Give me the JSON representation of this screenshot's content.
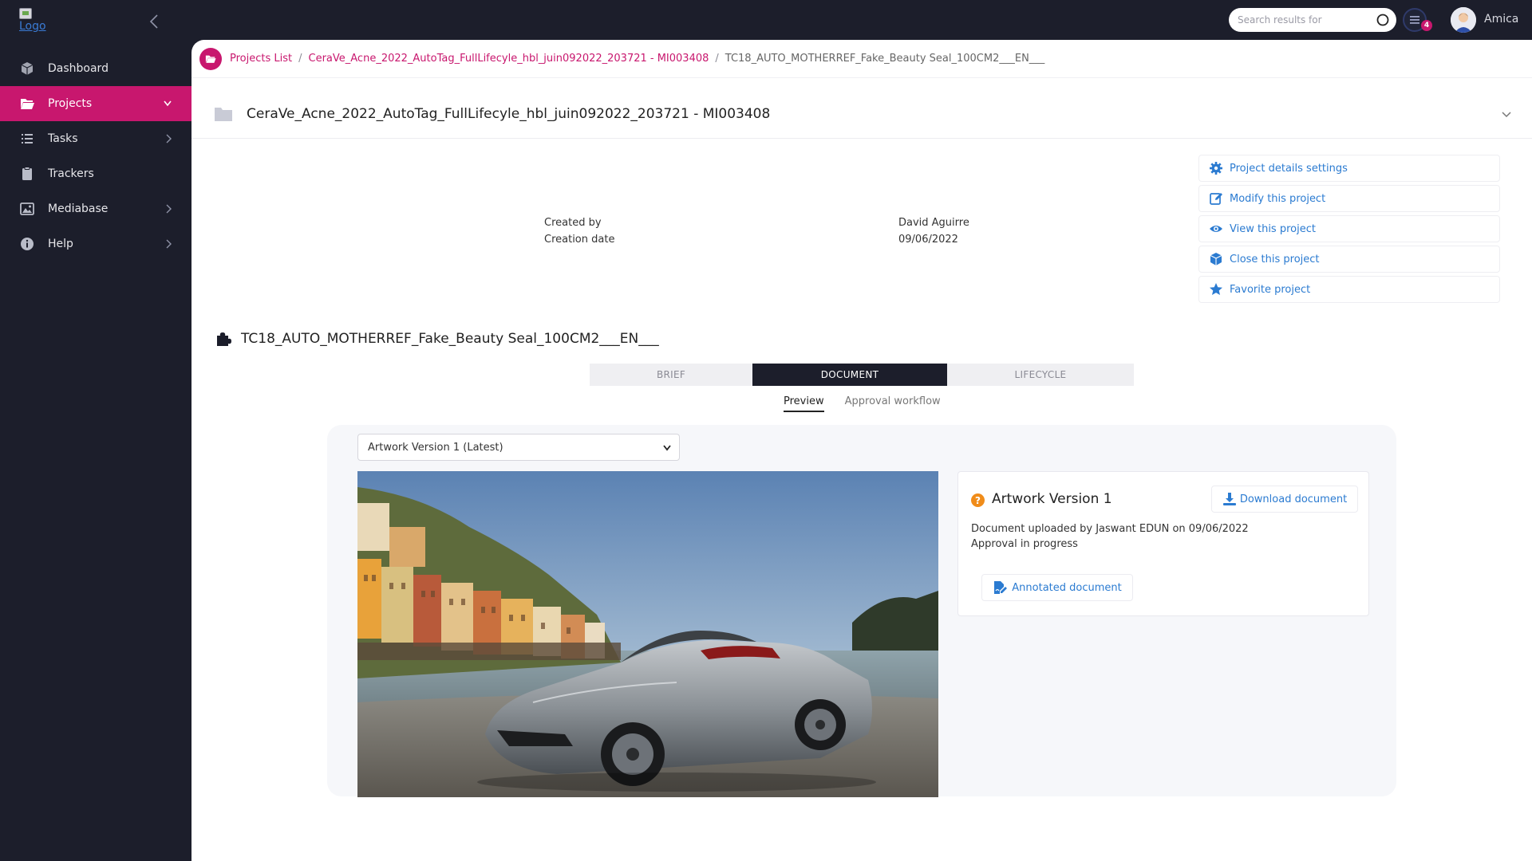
{
  "sidebar": {
    "logo_alt": "Logo",
    "items": [
      {
        "label": "Dashboard",
        "icon": "cube-icon",
        "has_children": false
      },
      {
        "label": "Projects",
        "icon": "folder-open-icon",
        "has_children": true,
        "active": true
      },
      {
        "label": "Tasks",
        "icon": "list-icon",
        "has_children": true
      },
      {
        "label": "Trackers",
        "icon": "clipboard-icon",
        "has_children": false
      },
      {
        "label": "Mediabase",
        "icon": "image-icon",
        "has_children": true
      },
      {
        "label": "Help",
        "icon": "info-icon",
        "has_children": true
      }
    ]
  },
  "topbar": {
    "search_placeholder": "Search results for",
    "notification_count": "4",
    "username": "Amica"
  },
  "breadcrumb": {
    "items": [
      "Projects List",
      "CeraVe_Acne_2022_AutoTag_FullLifecyle_hbl_juin092022_203721 - MI003408"
    ],
    "current": "TC18_AUTO_MOTHERREF_Fake_Beauty Seal_100CM2___EN___"
  },
  "project": {
    "title": "CeraVe_Acne_2022_AutoTag_FullLifecyle_hbl_juin092022_203721 - MI003408",
    "created_by_label": "Created by",
    "creation_date_label": "Creation date",
    "created_by": "David Aguirre",
    "creation_date": "09/06/2022"
  },
  "actions": [
    {
      "label": "Project details settings",
      "icon": "gear-icon"
    },
    {
      "label": "Modify this project",
      "icon": "edit-icon"
    },
    {
      "label": "View this project",
      "icon": "eye-icon"
    },
    {
      "label": "Close this project",
      "icon": "box-icon"
    },
    {
      "label": "Favorite project",
      "icon": "star-icon"
    }
  ],
  "document": {
    "title": "TC18_AUTO_MOTHERREF_Fake_Beauty Seal_100CM2___EN___",
    "tabs": [
      "BRIEF",
      "DOCUMENT",
      "LIFECYCLE"
    ],
    "active_tab": "DOCUMENT",
    "subtabs": [
      "Preview",
      "Approval workflow"
    ],
    "active_subtab": "Preview",
    "version_selected": "Artwork Version 1 (Latest)"
  },
  "artwork_info": {
    "title": "Artwork Version 1",
    "download_label": "Download document",
    "uploaded_text": "Document uploaded by Jaswant EDUN on 09/06/2022",
    "status_text": "Approval in progress",
    "annotated_label": "Annotated document"
  },
  "colors": {
    "brand": "#c8176e",
    "sidebar_bg": "#1c1e2b",
    "link": "#2b7bd1",
    "status_orange": "#f08c1a"
  }
}
